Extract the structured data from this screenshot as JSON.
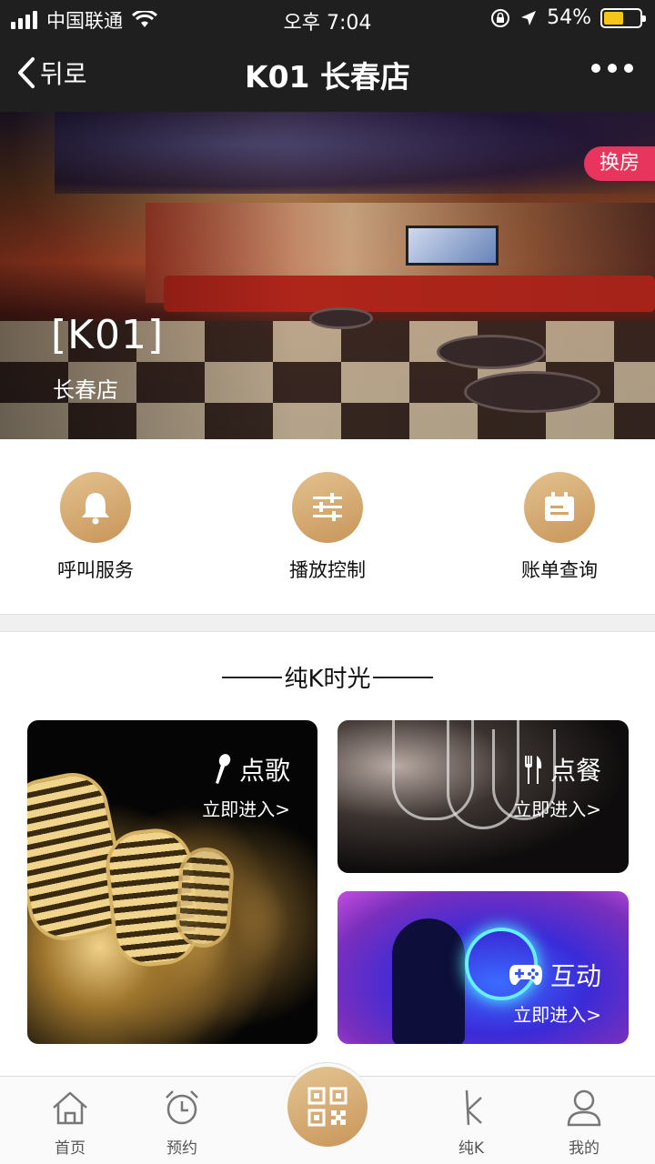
{
  "status_bar": {
    "carrier": "中国联通",
    "time": "오후 7:04",
    "battery_percent": "54%",
    "battery_level": 0.54,
    "battery_color": "#f5c518"
  },
  "nav": {
    "back_label": "뒤로",
    "title": "K01 长春店",
    "more_icon": "more-dots-icon"
  },
  "hero": {
    "room_code": "[K01]",
    "store_name": "长春店",
    "switch_room": "换房",
    "badge_color": "#e9355d"
  },
  "services": [
    {
      "label": "呼叫服务",
      "icon": "bell-icon"
    },
    {
      "label": "播放控制",
      "icon": "sliders-icon"
    },
    {
      "label": "账单查询",
      "icon": "bill-icon"
    }
  ],
  "section": {
    "title": "纯K时光"
  },
  "cards": {
    "song": {
      "name": "点歌",
      "enter": "立即进入>",
      "icon": "microphone-icon"
    },
    "food": {
      "name": "点餐",
      "enter": "立即进入>",
      "icon": "fork-knife-icon"
    },
    "fun": {
      "name": "互动",
      "enter": "立即进入>",
      "icon": "gamepad-icon"
    }
  },
  "tabbar": {
    "tabs": [
      {
        "label": "首页",
        "icon": "home-icon"
      },
      {
        "label": "预约",
        "icon": "alarm-clock-icon"
      },
      {
        "label": "纯K",
        "icon": "k-logo-icon"
      },
      {
        "label": "我的",
        "icon": "user-icon"
      }
    ],
    "center_icon": "qr-code-icon"
  },
  "colors": {
    "accent_gold": "#c8965a",
    "topbar": "#1f1f20"
  }
}
